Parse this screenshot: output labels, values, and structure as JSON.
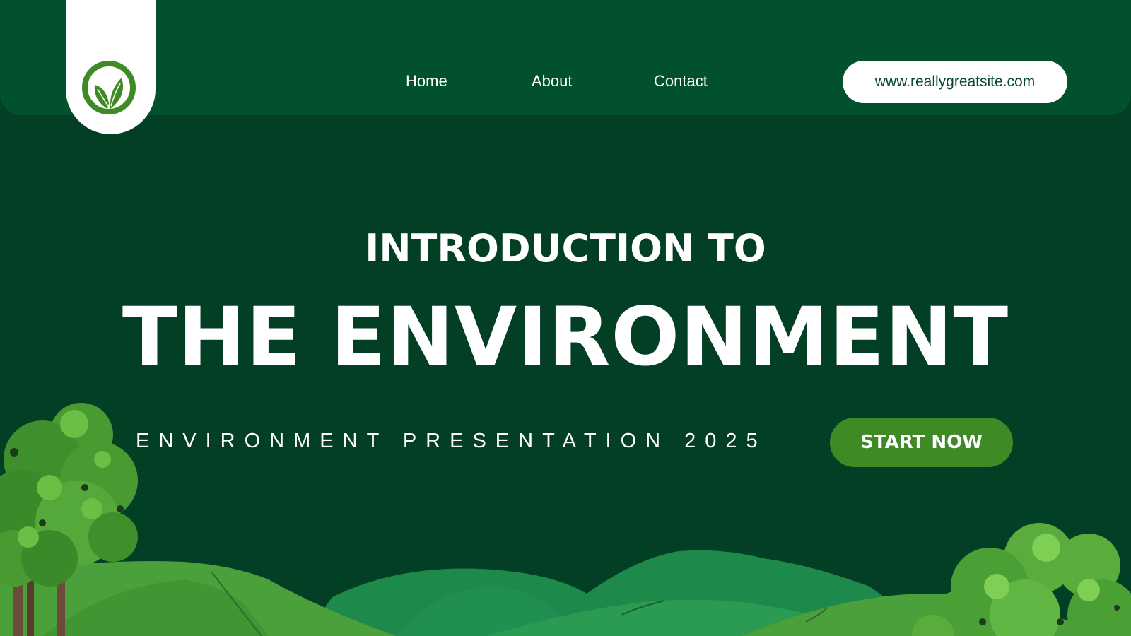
{
  "brand": {
    "logo_icon": "leaf-logo-icon",
    "colors": {
      "background": "#023f24",
      "header": "#02512e",
      "accent": "#3e8b25",
      "text": "#ffffff"
    }
  },
  "nav": {
    "items": [
      {
        "label": "Home"
      },
      {
        "label": "About"
      },
      {
        "label": "Contact"
      }
    ],
    "website": "www.reallygreatsite.com"
  },
  "hero": {
    "line1": "INTRODUCTION TO",
    "line2": "THE ENVIRONMENT",
    "subtitle": "ENVIRONMENT PRESENTATION 2025",
    "cta_label": "START NOW"
  }
}
